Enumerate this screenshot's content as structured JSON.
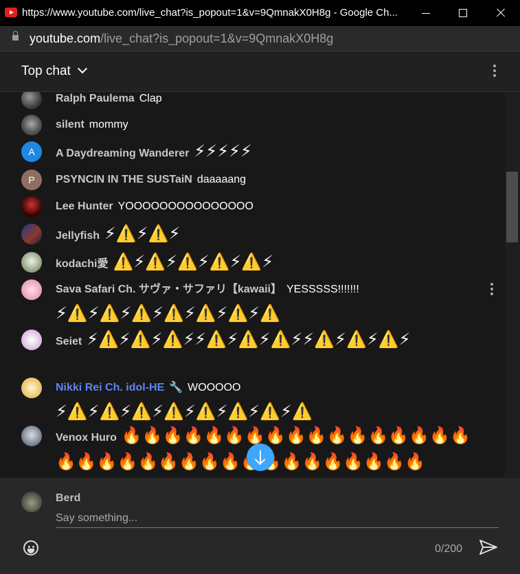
{
  "window": {
    "title": "https://www.youtube.com/live_chat?is_popout=1&v=9QmnakX0H8g - Google Ch..."
  },
  "address": {
    "host": "youtube.com",
    "path": "/live_chat?is_popout=1&v=9QmnakX0H8g"
  },
  "chat": {
    "mode": "Top chat"
  },
  "messages": [
    {
      "author": "Ralph Paulema",
      "text": "Clap",
      "emoji": ""
    },
    {
      "author": "silent",
      "text": "mommy",
      "emoji": ""
    },
    {
      "author": "A Daydreaming Wanderer",
      "text": "",
      "emoji": "⚡⚡⚡⚡⚡",
      "avatar_letter": "A",
      "avatar_color": "#1e88e5"
    },
    {
      "author": "PSYNCIN IN THE SUSTaiN",
      "text": "daaaaang",
      "emoji": "",
      "avatar_letter": "P",
      "avatar_color": "#8d6e63"
    },
    {
      "author": "Lee Hunter",
      "text": "YOOOOOOOOOOOOOOO",
      "emoji": ""
    },
    {
      "author": "Jellyfish",
      "text": "",
      "emoji": "⚡⚠️⚡⚠️⚡"
    },
    {
      "author": "kodachi愛",
      "text": "",
      "emoji": "⚠️⚡⚠️⚡⚠️⚡⚠️⚡⚠️⚡"
    },
    {
      "author": "Sava Safari Ch. サヴァ・サファリ【kawaii】",
      "text": "YESSSSS!!!!!!!",
      "emoji": "⚡⚠️⚡⚠️⚡⚠️⚡⚠️⚡⚠️⚡⚠️⚡⚠️"
    },
    {
      "author": "Seiet",
      "text": "",
      "emoji": "⚡⚠️⚡⚠️⚡⚠️⚡⚡⚠️⚡⚠️⚡⚠️⚡⚡⚠️⚡⚠️⚡⚠️⚡"
    },
    {
      "author": "Nikki Rei Ch. idol-HE",
      "text": "WOOOOO",
      "emoji": "⚡⚠️⚡⚠️⚡⚠️⚡⚠️⚡⚠️⚡⚠️⚡⚠️⚡⚠️",
      "member": true
    },
    {
      "author": "Venox Huro",
      "text": "",
      "emoji": "🔥🔥🔥🔥🔥🔥🔥🔥🔥🔥🔥🔥🔥🔥🔥🔥🔥🔥🔥🔥🔥🔥🔥🔥🔥🔥🔥🔥🔥🔥🔥🔥🔥🔥🔥"
    }
  ],
  "input": {
    "user": "Berd",
    "placeholder": "Say something...",
    "counter": "0/200"
  },
  "colors": {
    "background": "#181818",
    "header": "#212121",
    "input_panel": "#282828",
    "accent": "#3ea6ff",
    "member_name": "#5e84f1"
  }
}
